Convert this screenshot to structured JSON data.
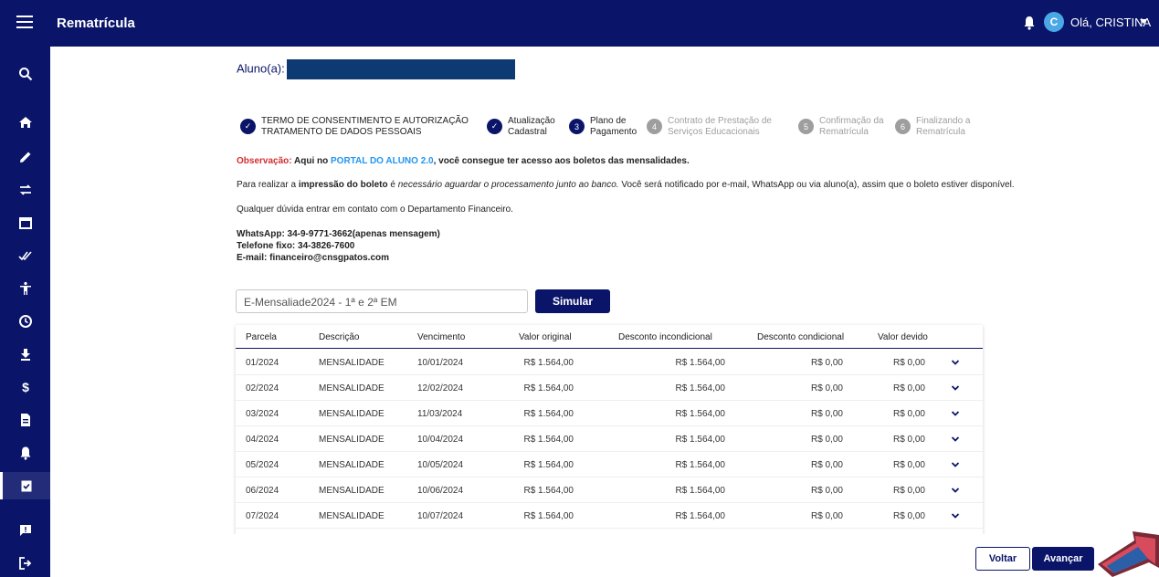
{
  "header": {
    "title": "Rematrícula",
    "avatar_initial": "C",
    "greeting": "Olá, CRISTINA"
  },
  "student": {
    "label": "Aluno(a):"
  },
  "steps": [
    {
      "num": "✓",
      "line1": "TERMO DE CONSENTIMENTO E AUTORIZAÇÃO",
      "line2": "TRATAMENTO DE DADOS PESSOAIS",
      "state": "done"
    },
    {
      "num": "✓",
      "line1": "Atualização",
      "line2": "Cadastral",
      "state": "done"
    },
    {
      "num": "3",
      "line1": "Plano de",
      "line2": "Pagamento",
      "state": "active"
    },
    {
      "num": "4",
      "line1": "Contrato de Prestação de",
      "line2": "Serviços Educacionais",
      "state": "todo"
    },
    {
      "num": "5",
      "line1": "Confirmação da",
      "line2": "Rematrícula",
      "state": "todo"
    },
    {
      "num": "6",
      "line1": "Finalizando a",
      "line2": "Rematrícula",
      "state": "todo"
    }
  ],
  "notice": {
    "obs_label": "Observação:",
    "obs_text1": " Aqui no ",
    "obs_link": "PORTAL DO ALUNO 2.0",
    "obs_text2": ", você consegue ter acesso aos boletos das mensalidades.",
    "p1_a": "Para realizar a ",
    "p1_b": "impressão do boleto",
    "p1_c": " é ",
    "p1_d": "necessário aguardar o processamento junto ao banco.",
    "p1_e": " Você será notificado por e-mail, WhatsApp ou via aluno(a), assim que o boleto estiver disponível.",
    "p2": "Qualquer dúvida entrar em contato com o Departamento Financeiro.",
    "whatsapp": "WhatsApp: 34-9-9771-3662(apenas mensagem)",
    "phone": "Telefone fixo: 34-3826-7600",
    "email": "E-mail: financeiro@cnsgpatos.com"
  },
  "plan": {
    "value": "E-Mensaliade2024 - 1ª e 2ª EM",
    "simulate_label": "Simular"
  },
  "table": {
    "headers": [
      "Parcela",
      "Descrição",
      "Vencimento",
      "Valor original",
      "Desconto incondicional",
      "Desconto condicional",
      "Valor devido"
    ],
    "rows": [
      [
        "01/2024",
        "MENSALIDADE",
        "10/01/2024",
        "R$ 1.564,00",
        "R$ 1.564,00",
        "R$ 0,00",
        "R$ 0,00"
      ],
      [
        "02/2024",
        "MENSALIDADE",
        "12/02/2024",
        "R$ 1.564,00",
        "R$ 1.564,00",
        "R$ 0,00",
        "R$ 0,00"
      ],
      [
        "03/2024",
        "MENSALIDADE",
        "11/03/2024",
        "R$ 1.564,00",
        "R$ 1.564,00",
        "R$ 0,00",
        "R$ 0,00"
      ],
      [
        "04/2024",
        "MENSALIDADE",
        "10/04/2024",
        "R$ 1.564,00",
        "R$ 1.564,00",
        "R$ 0,00",
        "R$ 0,00"
      ],
      [
        "05/2024",
        "MENSALIDADE",
        "10/05/2024",
        "R$ 1.564,00",
        "R$ 1.564,00",
        "R$ 0,00",
        "R$ 0,00"
      ],
      [
        "06/2024",
        "MENSALIDADE",
        "10/06/2024",
        "R$ 1.564,00",
        "R$ 1.564,00",
        "R$ 0,00",
        "R$ 0,00"
      ],
      [
        "07/2024",
        "MENSALIDADE",
        "10/07/2024",
        "R$ 1.564,00",
        "R$ 1.564,00",
        "R$ 0,00",
        "R$ 0,00"
      ]
    ]
  },
  "footer": {
    "back_label": "Voltar",
    "next_label": "Avançar"
  },
  "sidebar": {
    "items": [
      {
        "icon": "search-icon"
      },
      {
        "icon": "home-icon"
      },
      {
        "icon": "pencil-icon"
      },
      {
        "icon": "swap-icon"
      },
      {
        "icon": "calendar-icon"
      },
      {
        "icon": "double-check-icon"
      },
      {
        "icon": "accessibility-icon"
      },
      {
        "icon": "clock-icon"
      },
      {
        "icon": "download-icon"
      },
      {
        "icon": "dollar-icon"
      },
      {
        "icon": "document-icon"
      },
      {
        "icon": "bell-icon"
      },
      {
        "icon": "clipboard-check-icon"
      },
      {
        "icon": "feedback-icon"
      },
      {
        "icon": "logout-icon"
      }
    ]
  },
  "colors": {
    "primary": "#0a1569",
    "accent_red": "#d32f2f",
    "link_blue": "#2196f3",
    "todo_gray": "#9e9e9e"
  }
}
